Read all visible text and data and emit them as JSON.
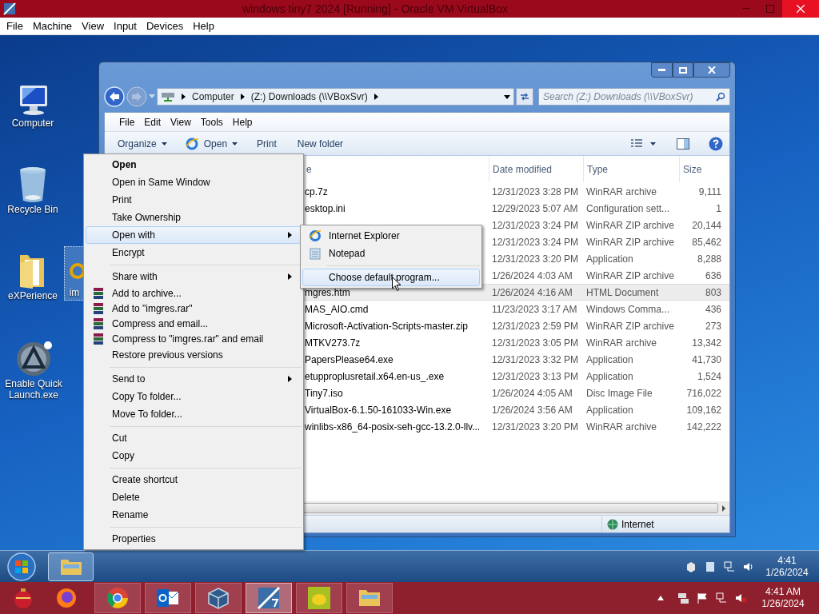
{
  "host_window": {
    "title": "windows tiny7 2024 [Running] - Oracle VM VirtualBox",
    "menu": [
      "File",
      "Machine",
      "View",
      "Input",
      "Devices",
      "Help"
    ]
  },
  "desktop_icons": [
    {
      "kind": "computer",
      "label": "Computer",
      "selected": false
    },
    {
      "kind": "recycle",
      "label": "Recycle Bin",
      "selected": false
    },
    {
      "kind": "folder",
      "label": "eXPerience",
      "selected": false
    },
    {
      "kind": "web-file",
      "label": "im",
      "selected": true
    },
    {
      "kind": "launcher",
      "label": "Enable Quick Launch.exe",
      "selected": false
    }
  ],
  "explorer": {
    "address": [
      "Computer",
      "(Z:) Downloads (\\\\VBoxSvr)"
    ],
    "search": {
      "placeholder": "Search (Z:) Downloads (\\\\VBoxSvr)"
    },
    "menu": [
      "File",
      "Edit",
      "View",
      "Tools",
      "Help"
    ],
    "toolbar": [
      {
        "kind": "dropdown",
        "label": "Organize"
      },
      {
        "kind": "open",
        "label": "Open"
      },
      {
        "kind": "plain",
        "label": "Print"
      },
      {
        "kind": "plain",
        "label": "New folder"
      }
    ],
    "columns": [
      "e",
      "Date modified",
      "Type",
      "Size"
    ],
    "rows": [
      {
        "name": "cp.7z",
        "date": "12/31/2023 3:28 PM",
        "type": "WinRAR archive",
        "size": "9,111",
        "selected": false
      },
      {
        "name": "esktop.ini",
        "date": "12/29/2023 5:07 AM",
        "type": "Configuration sett...",
        "size": "1",
        "selected": false
      },
      {
        "date": "12/31/2023 3:24 PM",
        "type": "WinRAR ZIP archive",
        "size": "20,144",
        "selected": false
      },
      {
        "date": "12/31/2023 3:24 PM",
        "type": "WinRAR ZIP archive",
        "size": "85,462",
        "selected": false
      },
      {
        "date": "12/31/2023 3:20 PM",
        "type": "Application",
        "size": "8,288",
        "selected": false
      },
      {
        "date": "1/26/2024 4:03 AM",
        "type": "WinRAR ZIP archive",
        "size": "636",
        "selected": false
      },
      {
        "name": "mgres.htm",
        "date": "1/26/2024 4:16 AM",
        "type": "HTML Document",
        "size": "803",
        "selected": true
      },
      {
        "name": "MAS_AIO.cmd",
        "date": "11/23/2023 3:17 AM",
        "type": "Windows Comma...",
        "size": "436",
        "selected": false
      },
      {
        "name": "Microsoft-Activation-Scripts-master.zip",
        "date": "12/31/2023 2:59 PM",
        "type": "WinRAR ZIP archive",
        "size": "273",
        "selected": false
      },
      {
        "name": "MTKV273.7z",
        "date": "12/31/2023 3:05 PM",
        "type": "WinRAR archive",
        "size": "13,342",
        "selected": false
      },
      {
        "name": "PapersPlease64.exe",
        "date": "12/31/2023 3:32 PM",
        "type": "Application",
        "size": "41,730",
        "selected": false
      },
      {
        "name": "etupproplusretail.x64.en-us_.exe",
        "date": "12/31/2023 3:13 PM",
        "type": "Application",
        "size": "1,524",
        "selected": false
      },
      {
        "name": "Tiny7.iso",
        "date": "1/26/2024 4:05 AM",
        "type": "Disc Image File",
        "size": "716,022",
        "selected": false
      },
      {
        "name": "VirtualBox-6.1.50-161033-Win.exe",
        "date": "1/26/2024 3:56 AM",
        "type": "Application",
        "size": "109,162",
        "selected": false
      },
      {
        "name": "winlibs-x86_64-posix-seh-gcc-13.2.0-llv...",
        "date": "12/31/2023 3:20 PM",
        "type": "WinRAR archive",
        "size": "142,222",
        "selected": false
      }
    ],
    "status": "Internet"
  },
  "context_menu": {
    "items": [
      {
        "kind": "item",
        "label": "Open",
        "bold": true,
        "submenu": false,
        "selected": false
      },
      {
        "kind": "item",
        "label": "Open in Same Window",
        "bold": false,
        "submenu": false,
        "selected": false
      },
      {
        "kind": "item",
        "label": "Print",
        "bold": false,
        "submenu": false,
        "selected": false
      },
      {
        "kind": "item",
        "label": "Take Ownership",
        "bold": false,
        "submenu": false,
        "selected": false
      },
      {
        "kind": "item",
        "label": "Open with",
        "bold": false,
        "submenu": true,
        "selected": true
      },
      {
        "kind": "item",
        "label": "Encrypt",
        "bold": false,
        "submenu": false,
        "selected": false
      },
      {
        "kind": "separator"
      },
      {
        "kind": "item",
        "label": "Share with",
        "bold": false,
        "submenu": true,
        "selected": false
      },
      {
        "kind": "archive",
        "label": "Add to archive...",
        "bold": false,
        "submenu": false,
        "selected": false
      },
      {
        "kind": "archive",
        "label": "Add to \"imgres.rar\"",
        "bold": false,
        "submenu": false,
        "selected": false
      },
      {
        "kind": "archive",
        "label": "Compress and email...",
        "bold": false,
        "submenu": false,
        "selected": false
      },
      {
        "kind": "archive",
        "label": "Compress to \"imgres.rar\" and email",
        "bold": false,
        "submenu": false,
        "selected": false
      },
      {
        "kind": "item",
        "label": "Restore previous versions",
        "bold": false,
        "submenu": false,
        "selected": false
      },
      {
        "kind": "separator"
      },
      {
        "kind": "item",
        "label": "Send to",
        "bold": false,
        "submenu": true,
        "selected": false
      },
      {
        "kind": "item",
        "label": "Copy To folder...",
        "bold": false,
        "submenu": false,
        "selected": false
      },
      {
        "kind": "item",
        "label": "Move To folder...",
        "bold": false,
        "submenu": false,
        "selected": false
      },
      {
        "kind": "separator"
      },
      {
        "kind": "item",
        "label": "Cut",
        "bold": false,
        "submenu": false,
        "selected": false
      },
      {
        "kind": "item",
        "label": "Copy",
        "bold": false,
        "submenu": false,
        "selected": false
      },
      {
        "kind": "separator"
      },
      {
        "kind": "item",
        "label": "Create shortcut",
        "bold": false,
        "submenu": false,
        "selected": false
      },
      {
        "kind": "item",
        "label": "Delete",
        "bold": false,
        "submenu": false,
        "selected": false
      },
      {
        "kind": "item",
        "label": "Rename",
        "bold": false,
        "submenu": false,
        "selected": false
      },
      {
        "kind": "separator"
      },
      {
        "kind": "item",
        "label": "Properties",
        "bold": false,
        "submenu": false,
        "selected": false
      }
    ]
  },
  "open_with_menu": {
    "items": [
      {
        "kind": "browser",
        "label": "Internet Explorer",
        "selected": false
      },
      {
        "kind": "editor",
        "label": "Notepad",
        "selected": false
      },
      {
        "kind": "separator"
      },
      {
        "kind": "action",
        "label": "Choose default program...",
        "selected": true
      }
    ]
  },
  "guest_taskbar": {
    "time": "4:41",
    "date": "1/26/2024"
  },
  "host_taskbar": {
    "time": "4:41 AM",
    "date": "1/26/2024"
  }
}
